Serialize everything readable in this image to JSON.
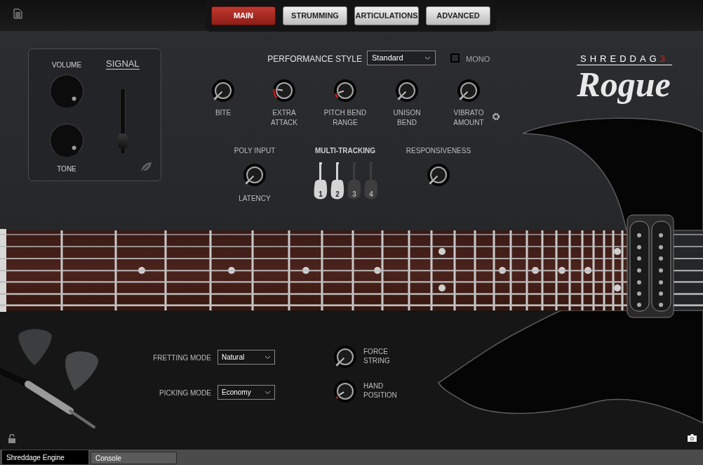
{
  "header": {
    "tabs": [
      {
        "label": "MAIN",
        "selected": true
      },
      {
        "label": "STRUMMING",
        "selected": false
      },
      {
        "label": "ARTICULATIONS",
        "selected": false
      },
      {
        "label": "ADVANCED",
        "selected": false
      }
    ]
  },
  "signal": {
    "title": "SIGNAL",
    "knobs": [
      {
        "label": "VOLUME",
        "level": 1
      },
      {
        "label": "TONE",
        "level": 1
      }
    ],
    "slider": {
      "level": 0.12
    }
  },
  "performance_style": {
    "label": "PERFORMANCE STYLE",
    "value": "Standard"
  },
  "mono": {
    "label": "MONO",
    "checked": false
  },
  "knobs": [
    {
      "label": "BITE",
      "level": 0
    },
    {
      "label": "EXTRA\nATTACK",
      "level": 0.2
    },
    {
      "label": "PITCH BEND\nRANGE",
      "level": 0.1
    },
    {
      "label": "UNISON\nBEND",
      "level": 0
    },
    {
      "label": "VIBRATO\nAMOUNT",
      "level": 0
    }
  ],
  "poly_input": {
    "title": "POLY INPUT",
    "knob_label": "LATENCY",
    "level": 0
  },
  "multi_tracking": {
    "title": "MULTI-TRACKING",
    "tracks": [
      {
        "label": "1",
        "on": true
      },
      {
        "label": "2",
        "on": true
      },
      {
        "label": "3",
        "on": false
      },
      {
        "label": "4",
        "on": false
      }
    ]
  },
  "responsiveness": {
    "label": "RESPONSIVENESS",
    "level": 0
  },
  "logo": {
    "brand": "SHREDDAG",
    "brand_suffix": "3",
    "product": "Rogue"
  },
  "modes": [
    {
      "label": "FRETTING MODE",
      "value": "Natural"
    },
    {
      "label": "PICKING MODE",
      "value": "Economy"
    }
  ],
  "lower_knobs": [
    {
      "label": "FORCE\nSTRING",
      "level": 0
    },
    {
      "label": "HAND\nPOSITION",
      "level": 0.05
    }
  ],
  "bottom_tabs": [
    {
      "label": "Shreddage Engine",
      "selected": true
    },
    {
      "label": "Console",
      "selected": false
    }
  ]
}
